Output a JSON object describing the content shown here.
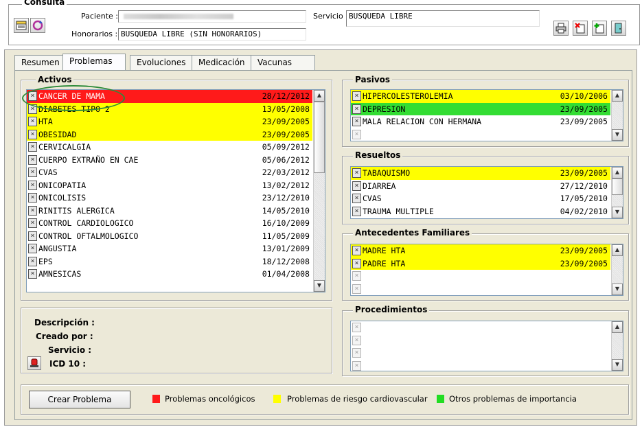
{
  "header": {
    "group_title": "Consulta",
    "paciente_label": "Paciente :",
    "paciente_value": "",
    "servicio_label": "Servicio :",
    "servicio_value": "BUSQUEDA LIBRE",
    "honorarios_label": "Honorarios :",
    "honorarios_value": "BUSQUEDA LIBRE (SIN HONORARIOS)"
  },
  "tabs": [
    {
      "label": "Resumen"
    },
    {
      "label": "Problemas"
    },
    {
      "label": "Evoluciones"
    },
    {
      "label": "Medicación"
    },
    {
      "label": "Vacunas"
    }
  ],
  "activos": {
    "title": "Activos",
    "rows": [
      {
        "name": "CANCER DE MAMA",
        "date": "28/12/2012",
        "color": "#ff1a1a"
      },
      {
        "name": "DIABETES TIPO 2",
        "date": "13/05/2008",
        "color": "#ffff00"
      },
      {
        "name": "HTA",
        "date": "23/09/2005",
        "color": "#ffff00"
      },
      {
        "name": "OBESIDAD",
        "date": "23/09/2005",
        "color": "#ffff00"
      },
      {
        "name": "CERVICALGIA",
        "date": "05/09/2012",
        "color": ""
      },
      {
        "name": "CUERPO EXTRAÑO EN CAE",
        "date": "05/06/2012",
        "color": ""
      },
      {
        "name": "CVAS",
        "date": "22/03/2012",
        "color": ""
      },
      {
        "name": "ONICOPATIA",
        "date": "13/02/2012",
        "color": ""
      },
      {
        "name": "ONICOLISIS",
        "date": "23/12/2010",
        "color": ""
      },
      {
        "name": "RINITIS ALERGICA",
        "date": "14/05/2010",
        "color": ""
      },
      {
        "name": "CONTROL CARDIOLOGICO",
        "date": "16/10/2009",
        "color": ""
      },
      {
        "name": "CONTROL OFTALMOLOGICO",
        "date": "11/05/2009",
        "color": ""
      },
      {
        "name": "ANGUSTIA",
        "date": "13/01/2009",
        "color": ""
      },
      {
        "name": "EPS",
        "date": "18/12/2008",
        "color": ""
      },
      {
        "name": "AMNESICAS",
        "date": "01/04/2008",
        "color": ""
      }
    ]
  },
  "pasivos": {
    "title": "Pasivos",
    "rows": [
      {
        "name": "HIPERCOLESTEROLEMIA",
        "date": "03/10/2006",
        "color": "#ffff00"
      },
      {
        "name": "DEPRESION",
        "date": "23/09/2005",
        "color": "#33dd33"
      },
      {
        "name": "MALA RELACION CON HERMANA",
        "date": "23/09/2005",
        "color": ""
      },
      {
        "name": "",
        "date": "",
        "color": ""
      }
    ]
  },
  "resueltos": {
    "title": "Resueltos",
    "rows": [
      {
        "name": "TABAQUISMO",
        "date": "23/09/2005",
        "color": "#ffff00"
      },
      {
        "name": "DIARREA",
        "date": "27/12/2010",
        "color": ""
      },
      {
        "name": "CVAS",
        "date": "17/05/2010",
        "color": ""
      },
      {
        "name": "TRAUMA MULTIPLE",
        "date": "04/02/2010",
        "color": ""
      }
    ]
  },
  "familiares": {
    "title": "Antecedentes Familiares",
    "rows": [
      {
        "name": "MADRE HTA",
        "date": "23/09/2005",
        "color": "#ffff00"
      },
      {
        "name": "PADRE HTA",
        "date": "23/09/2005",
        "color": "#ffff00"
      },
      {
        "name": "",
        "date": "",
        "color": ""
      },
      {
        "name": "",
        "date": "",
        "color": ""
      }
    ]
  },
  "procedimientos": {
    "title": "Procedimientos",
    "rows": [
      {
        "name": "",
        "date": "",
        "color": ""
      },
      {
        "name": "",
        "date": "",
        "color": ""
      },
      {
        "name": "",
        "date": "",
        "color": ""
      },
      {
        "name": "",
        "date": "",
        "color": ""
      }
    ]
  },
  "details": {
    "descripcion": "Descripción :",
    "creado_por": "Creado por :",
    "servicio": "Servicio :",
    "icd10": "ICD 10 :"
  },
  "footer": {
    "crear_button": "Crear Problema",
    "legend": [
      {
        "label": "Problemas oncológicos",
        "color": "#ff1a1a"
      },
      {
        "label": "Problemas de riesgo cardiovascular",
        "color": "#ffff00"
      },
      {
        "label": "Otros problemas de importancia",
        "color": "#22dd22"
      }
    ]
  },
  "icons": [
    "folder-icon",
    "refresh-icon",
    "print-icon",
    "delete-icon",
    "add-icon",
    "exit-icon",
    "alert-icon"
  ]
}
